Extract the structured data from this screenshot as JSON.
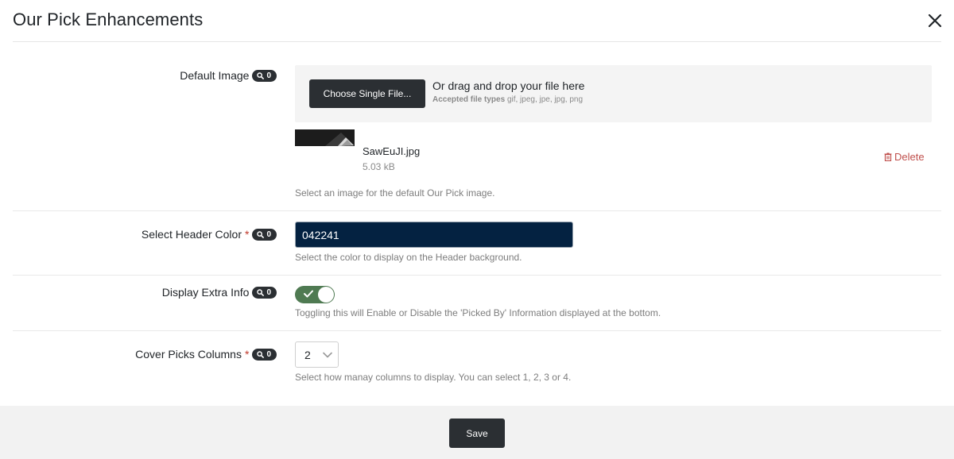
{
  "modal": {
    "title": "Our Pick Enhancements",
    "close_icon": "close-icon"
  },
  "fields": {
    "default_image": {
      "label": "Default Image",
      "badge_count": "0",
      "upload": {
        "button_label": "Choose Single File...",
        "drop_text": "Or drag and drop your file here",
        "accepted_label": "Accepted file types",
        "accepted_types": "gif, jpeg, jpe, jpg, png"
      },
      "file": {
        "name": "SawEuJI.jpg",
        "size": "5.03 kB",
        "delete_label": "Delete"
      },
      "help": "Select an image for the default Our Pick image."
    },
    "header_color": {
      "label": "Select Header Color",
      "required_mark": "*",
      "badge_count": "0",
      "value": "042241",
      "swatch_color": "#042241",
      "help": "Select the color to display on the Header background."
    },
    "extra_info": {
      "label": "Display Extra Info",
      "badge_count": "0",
      "enabled": true,
      "toggle_color": "#4f7a52",
      "help": "Toggling this will Enable or Disable the 'Picked By' Information displayed at the bottom."
    },
    "cover_columns": {
      "label": "Cover Picks Columns",
      "required_mark": "*",
      "badge_count": "0",
      "value": "2",
      "help": "Select how manay columns to display. You can select 1, 2, 3 or 4."
    }
  },
  "footer": {
    "save_label": "Save"
  },
  "icons": {
    "badge": "search-icon",
    "delete": "trash-icon",
    "toggle": "check-icon",
    "select": "chevron-down-icon"
  }
}
